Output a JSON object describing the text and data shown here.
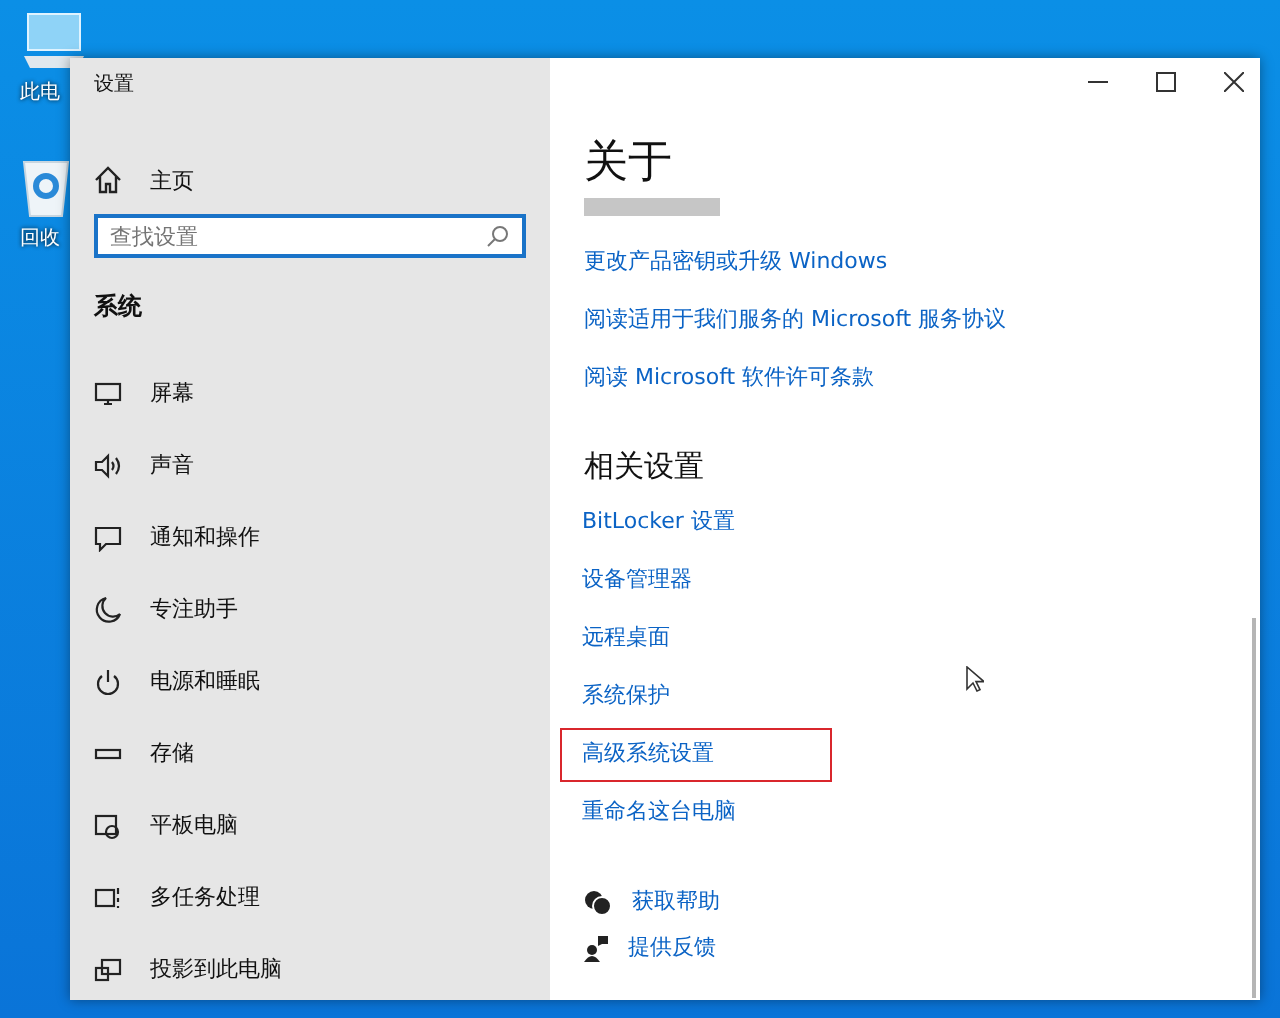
{
  "desktop": {
    "icons": [
      "此电",
      "回收"
    ]
  },
  "window": {
    "title": "设置"
  },
  "sidebar": {
    "home": "主页",
    "search": {
      "placeholder": "查找设置"
    },
    "section": "系统",
    "items": [
      {
        "label": "屏幕",
        "selected": false
      },
      {
        "label": "声音",
        "selected": false
      },
      {
        "label": "通知和操作",
        "selected": false
      },
      {
        "label": "专注助手",
        "selected": false
      },
      {
        "label": "电源和睡眠",
        "selected": false
      },
      {
        "label": "存储",
        "selected": false
      },
      {
        "label": "平板电脑",
        "selected": false
      },
      {
        "label": "多任务处理",
        "selected": false
      },
      {
        "label": "投影到此电脑",
        "selected": false
      }
    ]
  },
  "content": {
    "title": "关于",
    "links": [
      "更改产品密钥或升级 Windows",
      "阅读适用于我们服务的 Microsoft 服务协议",
      "阅读 Microsoft 软件许可条款"
    ],
    "related_title": "相关设置",
    "related": [
      {
        "label": "BitLocker 设置",
        "highlighted": false
      },
      {
        "label": "设备管理器",
        "highlighted": false
      },
      {
        "label": "远程桌面",
        "highlighted": false
      },
      {
        "label": "系统保护",
        "highlighted": false
      },
      {
        "label": "高级系统设置",
        "highlighted": true
      },
      {
        "label": "重命名这台电脑",
        "highlighted": false
      }
    ],
    "help": [
      "获取帮助",
      "提供反馈"
    ]
  }
}
